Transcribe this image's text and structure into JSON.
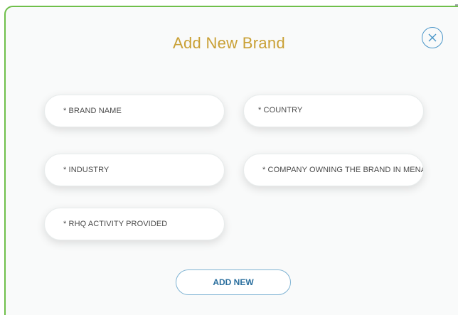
{
  "modal": {
    "title": "Add New Brand",
    "close_icon": "close-icon"
  },
  "form": {
    "fields": [
      {
        "label": "* BRAND NAME"
      },
      {
        "label": "* COUNTRY"
      },
      {
        "label": "* INDUSTRY"
      },
      {
        "label": "* COMPANY OWNING THE BRAND IN MENA"
      },
      {
        "label": "* RHQ ACTIVITY PROVIDED"
      }
    ],
    "submit_label": "ADD NEW"
  },
  "colors": {
    "border_accent": "#6fbf4a",
    "title_gold": "#c9a035",
    "button_blue": "#2b6f9e",
    "close_blue": "#4a95c8"
  }
}
